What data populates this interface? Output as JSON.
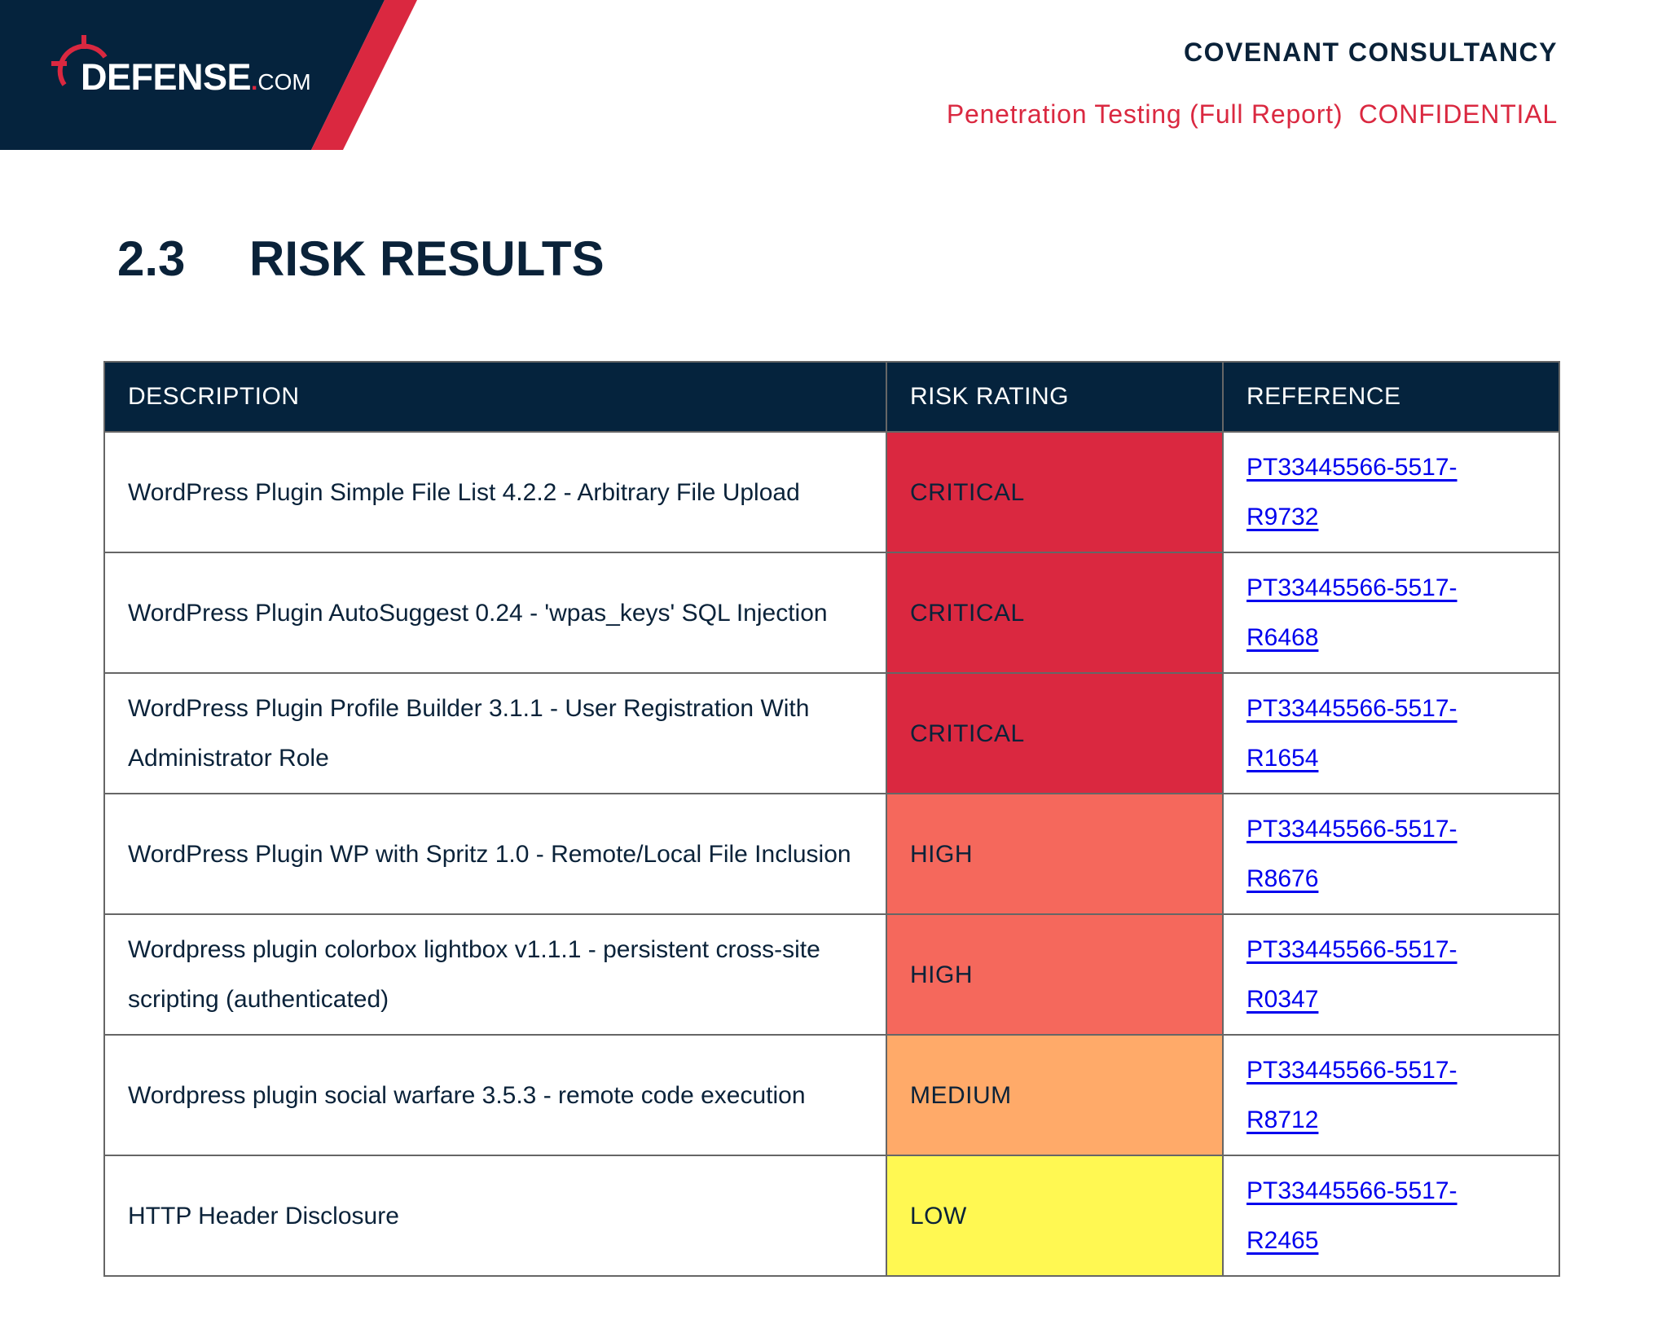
{
  "header": {
    "logo": {
      "main": "DEFENSE",
      "dot": ".",
      "tld": "COM",
      "icon": "crosshair-icon"
    },
    "company": "COVENANT CONSULTANCY",
    "subtitle": "Penetration Testing (Full Report)  CONFIDENTIAL"
  },
  "section": {
    "number": "2.3",
    "title": "RISK RESULTS"
  },
  "table": {
    "columns": [
      "DESCRIPTION",
      "RISK RATING",
      "REFERENCE"
    ],
    "rows": [
      {
        "description": "WordPress Plugin Simple File List 4.2.2 - Arbitrary File Upload",
        "risk": "CRITICAL",
        "reference": "PT33445566-5517-R9732"
      },
      {
        "description": "WordPress Plugin AutoSuggest 0.24 - 'wpas_keys' SQL Injection",
        "risk": "CRITICAL",
        "reference": "PT33445566-5517-R6468"
      },
      {
        "description": "WordPress Plugin Profile Builder  3.1.1 - User Registration With Administrator Role",
        "risk": "CRITICAL",
        "reference": "PT33445566-5517-R1654"
      },
      {
        "description": "WordPress Plugin WP with Spritz 1.0 - Remote/Local File Inclusion",
        "risk": "HIGH",
        "reference": "PT33445566-5517-R8676"
      },
      {
        "description": "Wordpress plugin colorbox lightbox v1.1.1 - persistent cross-site scripting (authenticated)",
        "risk": "HIGH",
        "reference": "PT33445566-5517-R0347"
      },
      {
        "description": "Wordpress plugin social warfare  3.5.3 - remote code execution",
        "risk": "MEDIUM",
        "reference": "PT33445566-5517-R8712"
      },
      {
        "description": "HTTP Header Disclosure",
        "risk": "LOW",
        "reference": "PT33445566-5517-R2465"
      }
    ]
  },
  "colors": {
    "navy": "#05233d",
    "brand_red": "#da2840",
    "critical": "#da2840",
    "high": "#f5685c",
    "medium": "#ffaa69",
    "low": "#fff852",
    "link": "#0000ee"
  }
}
